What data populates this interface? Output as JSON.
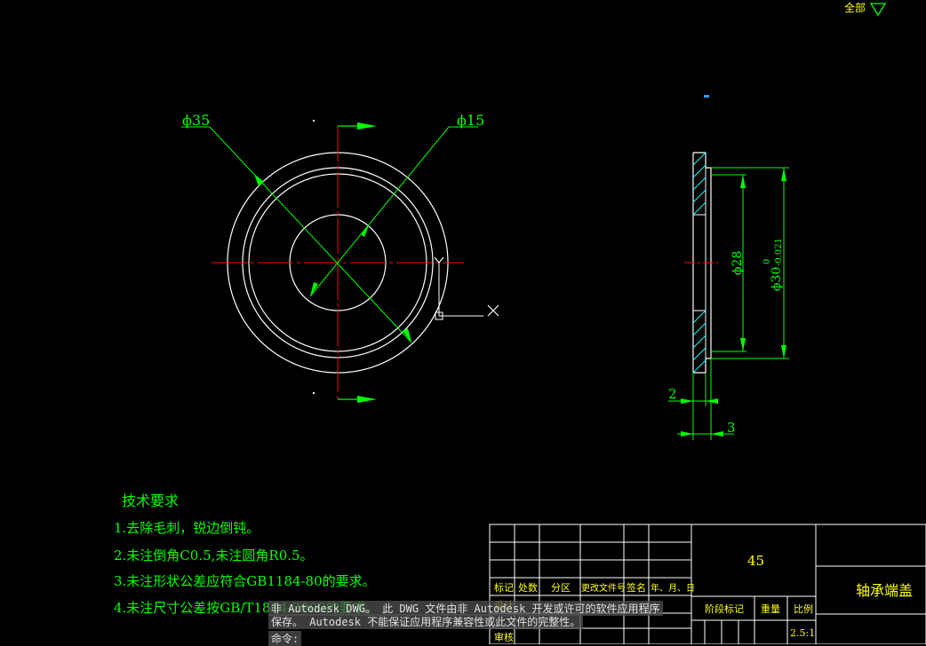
{
  "colors": {
    "background": "#000000",
    "outline": "#ffffff",
    "dimension": "#00ff00",
    "centerline": "#ff0000",
    "text": "#00ff00",
    "titleblock_text": "#ffff00",
    "titleblock_line": "#ffffff",
    "cmd_bg": "#505050",
    "cmd_text": "#e0e0e0",
    "hatch": "#00ffff"
  },
  "view_control": {
    "label": "全部",
    "icon": "triangle-down-icon"
  },
  "front_view": {
    "dim_large": "ϕ35",
    "dim_small": "ϕ15"
  },
  "side_view": {
    "dim_inner": "ϕ28",
    "dim_outer": "ϕ30",
    "tol_upper": "0",
    "tol_lower": "-0.021",
    "dim_thick_1": "2",
    "dim_thick_2": "3"
  },
  "tech_req": {
    "title": "技术要求",
    "items": [
      "1.去除毛刺，锐边倒钝。",
      "2.未注倒角C0.5,未注圆角R0.5。",
      "3.未注形状公差应符合GB1184-80的要求。",
      "4.未注尺寸公差按GB/T1804-2000的要求。"
    ]
  },
  "title_block": {
    "material": "45",
    "part_name": "轴承端盖",
    "headers": [
      "标记",
      "处数",
      "分区",
      "更改文件号",
      "签名",
      "年、月、日"
    ],
    "row_labels": [
      "设计",
      "审核"
    ],
    "stage_label": "阶段标记",
    "weight_label": "重量",
    "scale_label": "比例",
    "scale_value": "2.5:1"
  },
  "command": {
    "warning_line1": "非 Autodesk DWG。  此 DWG 文件由非 Autodesk 开发或许可的软件应用程序",
    "warning_line2": "保存。  Autodesk 不能保证应用程序兼容性或此文件的完整性。",
    "prompt": "命令:"
  }
}
